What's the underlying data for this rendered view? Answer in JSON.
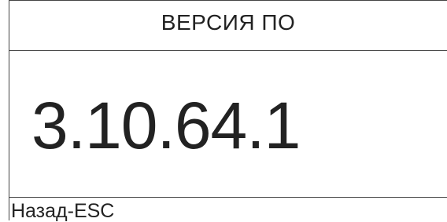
{
  "screen": {
    "title": "ВЕРСИЯ ПО",
    "version": "3.10.64.1",
    "back_hint": "Назад-ESC"
  }
}
